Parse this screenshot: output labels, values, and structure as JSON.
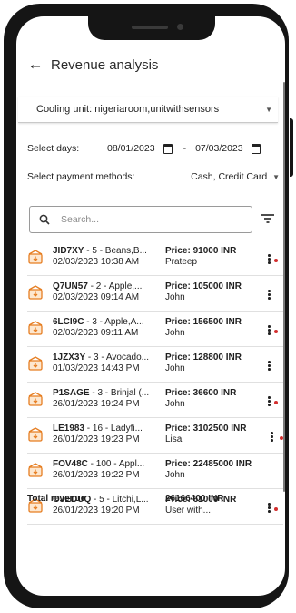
{
  "header": {
    "title": "Revenue analysis"
  },
  "cooling_unit": {
    "label": "Cooling unit:",
    "value": "nigeriaroom,unitwithsensors"
  },
  "days": {
    "label": "Select days:",
    "from": "08/01/2023",
    "separator": "-",
    "to": "07/03/2023"
  },
  "payment": {
    "label": "Select payment methods:",
    "value": "Cash, Credit Card"
  },
  "search": {
    "placeholder": "Search..."
  },
  "colors": {
    "accent": "#e67e22",
    "status_dot": "#d32f2f"
  },
  "icons": {
    "back": "arrow-left-icon",
    "calendar": "calendar-icon",
    "search": "search-icon",
    "filter": "filter-icon",
    "item": "crate-download-icon",
    "more": "more-vert-icon"
  },
  "items": [
    {
      "code": "JID7XY",
      "desc": " - 5 - Beans,B...",
      "date": "02/03/2023 10:38 AM",
      "price": "Price: 91000 INR",
      "user": "Prateep",
      "has_dot": true
    },
    {
      "code": "Q7UN57",
      "desc": " - 2 - Apple,...",
      "date": "02/03/2023 09:14 AM",
      "price": "Price: 105000 INR",
      "user": "John",
      "has_dot": false
    },
    {
      "code": "6LCI9C",
      "desc": " - 3 - Apple,A...",
      "date": "02/03/2023 09:11 AM",
      "price": "Price: 156500 INR",
      "user": "John",
      "has_dot": true
    },
    {
      "code": "1JZX3Y",
      "desc": " - 3 - Avocado...",
      "date": "01/03/2023 14:43 PM",
      "price": "Price: 128800 INR",
      "user": "John",
      "has_dot": false
    },
    {
      "code": "P1SAGE",
      "desc": " - 3 - Brinjal (...",
      "date": "26/01/2023 19:24 PM",
      "price": "Price: 36600 INR",
      "user": "John",
      "has_dot": true
    },
    {
      "code": "LE1983",
      "desc": " - 16 - Ladyfi...",
      "date": "26/01/2023 19:23 PM",
      "price": "Price: 3102500 INR",
      "user": "Lisa",
      "has_dot": true
    },
    {
      "code": "FOV48C",
      "desc": " - 100 - Appl...",
      "date": "26/01/2023 19:22 PM",
      "price": "Price: 22485000 INR",
      "user": "John",
      "has_dot": true
    },
    {
      "code": "OJEDUQ",
      "desc": " - 5 - Litchi,L...",
      "date": "26/01/2023 19:20 PM",
      "price": "Price: 61000 INR",
      "user": "User with...",
      "has_dot": true
    }
  ],
  "total": {
    "label": "Total revenue",
    "value": "26166400 INR"
  }
}
